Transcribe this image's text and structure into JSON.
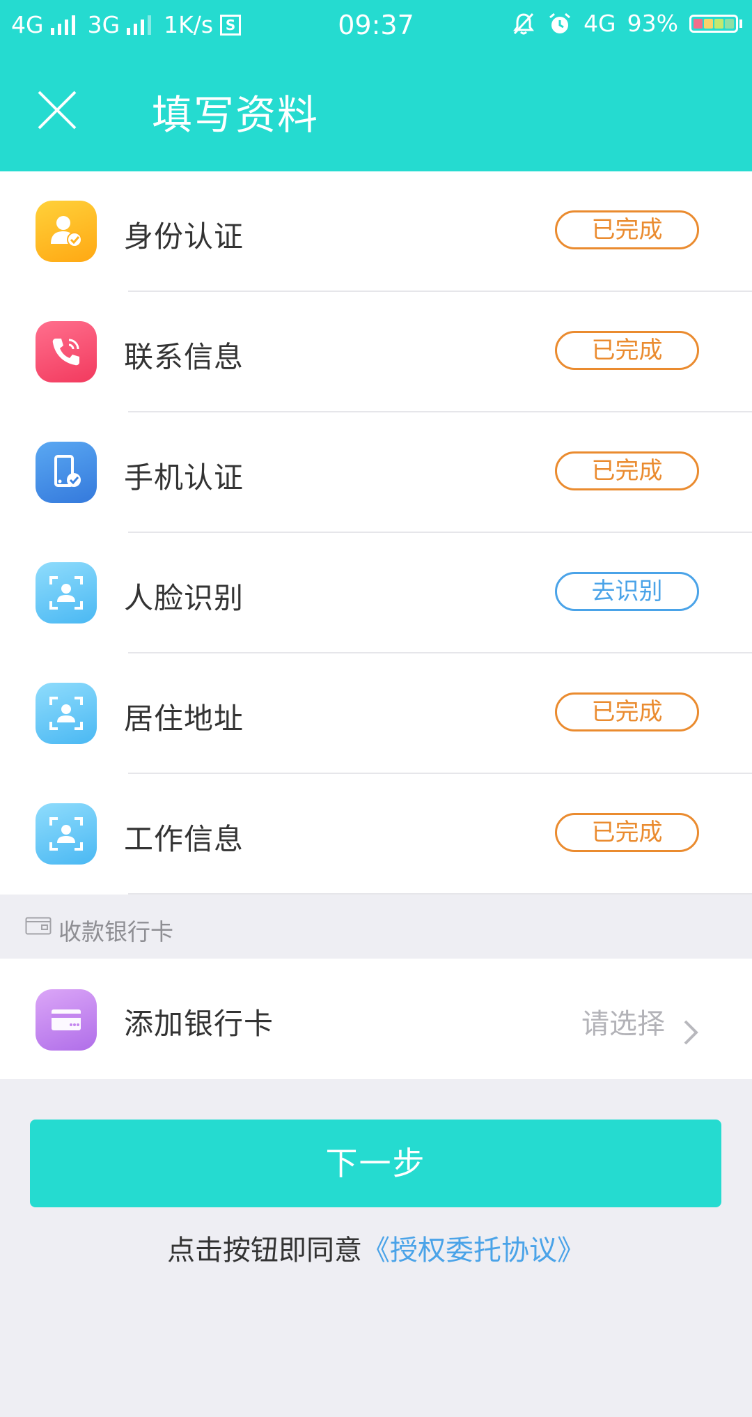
{
  "status_bar": {
    "net1": "4G",
    "net2": "3G",
    "speed": "1K/s",
    "sim": "S",
    "time": "09:37",
    "net3": "4G",
    "battery": "93%",
    "battery_level": 0.93
  },
  "header": {
    "title": "填写资料",
    "close_icon": "close-icon",
    "background": "#25dbd0"
  },
  "items": [
    {
      "label": "身份认证",
      "status": "已完成",
      "icon": "id-verify-icon",
      "state": "done"
    },
    {
      "label": "联系信息",
      "status": "已完成",
      "icon": "phone-call-icon",
      "state": "done"
    },
    {
      "label": "手机认证",
      "status": "已完成",
      "icon": "mobile-verify-icon",
      "state": "done"
    },
    {
      "label": "人脸识别",
      "status": "去识别",
      "icon": "face-scan-icon",
      "state": "todo"
    },
    {
      "label": "居住地址",
      "status": "已完成",
      "icon": "face-scan-icon",
      "state": "done"
    },
    {
      "label": "工作信息",
      "status": "已完成",
      "icon": "face-scan-icon",
      "state": "done"
    }
  ],
  "section": {
    "title": "收款银行卡",
    "icon": "wallet-icon"
  },
  "bank_card": {
    "label": "添加银行卡",
    "value": "请选择",
    "icon": "bank-card-icon"
  },
  "next_button": {
    "label": "下一步"
  },
  "agreement": {
    "prefix": "点击按钮即同意",
    "link": "《授权委托协议》"
  },
  "colors": {
    "accent": "#25dbd0",
    "done": "#ea8b2f",
    "todo": "#4aa3e8",
    "link": "#4aa3e8"
  }
}
